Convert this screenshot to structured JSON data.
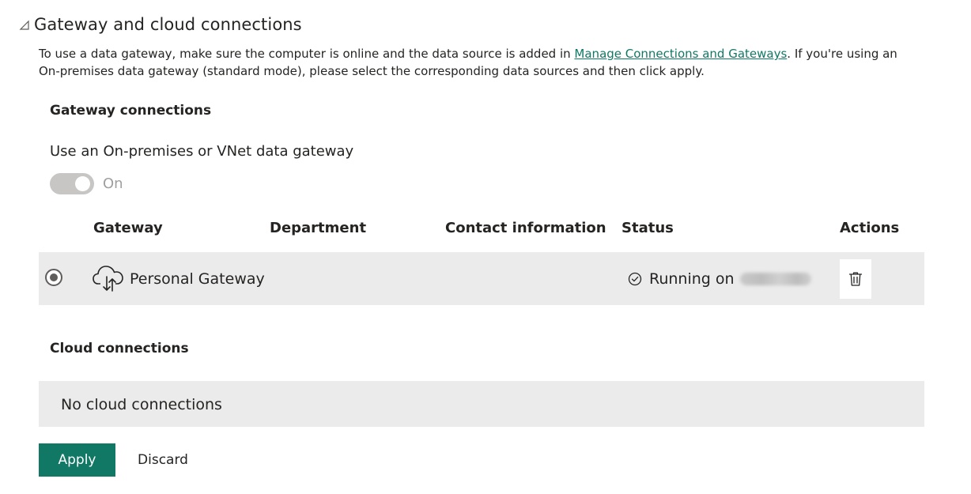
{
  "section": {
    "title": "Gateway and cloud connections",
    "collapse_icon": "collapse-triangle-icon"
  },
  "description": {
    "before_link": "To use a data gateway, make sure the computer is online and the data source is added in ",
    "link_text": "Manage Connections and Gateways",
    "after_link": ". If you're using an On-premises data gateway (standard mode), please select the corresponding data sources and then click apply."
  },
  "gateway_connections": {
    "heading": "Gateway connections",
    "toggle_label": "Use an On-premises or VNet data gateway",
    "toggle_state": "On",
    "toggle_on": true,
    "columns": [
      "Gateway",
      "Department",
      "Contact information",
      "Status",
      "Actions"
    ],
    "rows": [
      {
        "selected": true,
        "icon": "cloud-sync-icon",
        "name": "Personal Gateway",
        "department": "",
        "contact": "",
        "status_icon": "check-circle-icon",
        "status": "Running on",
        "action_icon": "trash-icon"
      }
    ]
  },
  "cloud_connections": {
    "heading": "Cloud connections",
    "empty_text": "No cloud connections"
  },
  "buttons": {
    "apply": "Apply",
    "discard": "Discard"
  },
  "colors": {
    "accent": "#117865",
    "row_background": "#ebebeb",
    "toggle_disabled": "#c8c6c4",
    "text": "#252423"
  }
}
